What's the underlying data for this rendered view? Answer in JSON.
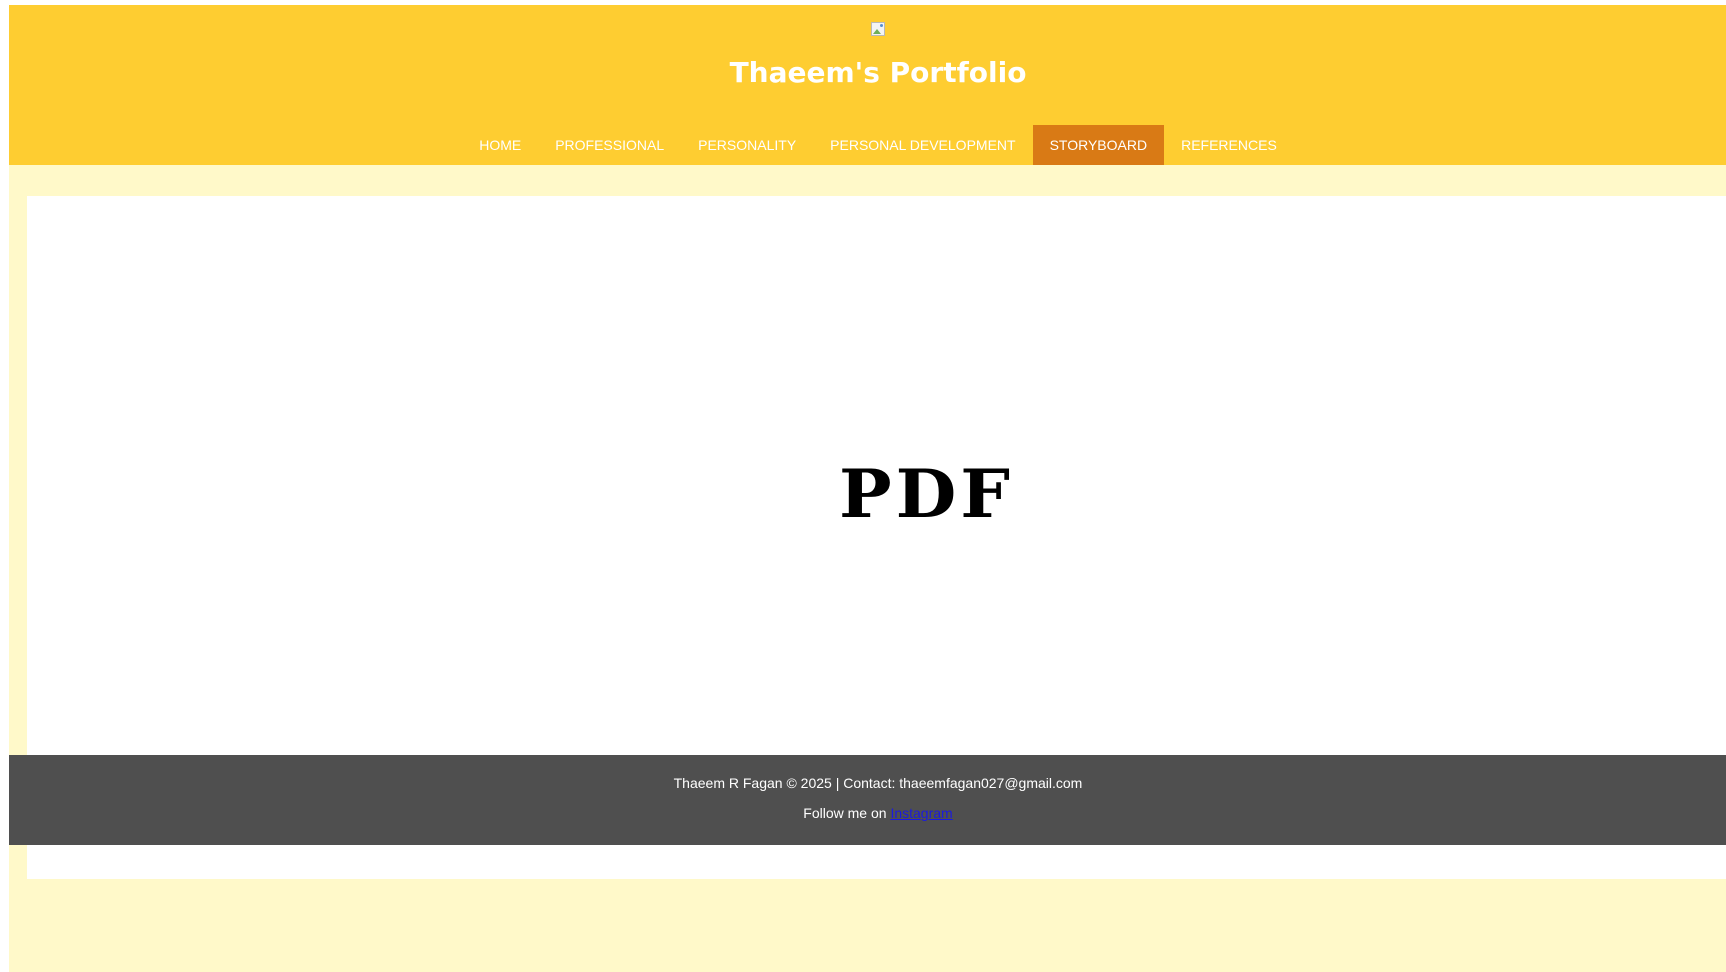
{
  "header": {
    "title": "Thaeem's Portfolio",
    "logo_icon": "broken-image-icon"
  },
  "nav": {
    "items": [
      {
        "label": "HOME"
      },
      {
        "label": "PROFESSIONAL"
      },
      {
        "label": "PERSONALITY"
      },
      {
        "label": "PERSONAL DEVELOPMENT"
      },
      {
        "label": "STORYBOARD",
        "active": true
      },
      {
        "label": "REFERENCES"
      }
    ]
  },
  "content": {
    "pdf_label": "PDF"
  },
  "footer": {
    "copyright": "Thaeem R Fagan © 2025 | Contact: thaeemfagan027@gmail.com",
    "follow_prefix": "Follow me on ",
    "instagram_label": "Instagram"
  },
  "colors": {
    "header_bg": "#fecd31",
    "nav_active_bg": "#d97a15",
    "page_bg": "#fff9c9",
    "footer_bg": "#4f4f4f",
    "link": "#1a1adf"
  }
}
